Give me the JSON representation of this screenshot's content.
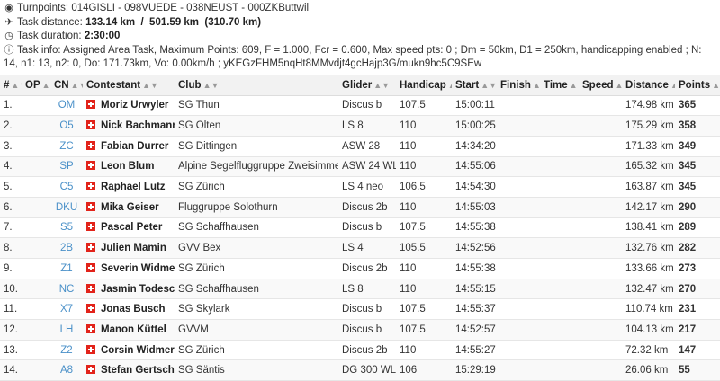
{
  "info": {
    "turnpoints_label": "Turnpoints:",
    "turnpoints_value": "014GISLI - 098VUEDE - 038NEUST - 000ZKButtwil",
    "distance_label": "Task distance:",
    "distance_value": "133.14 km  /  501.59 km  (310.70 km)",
    "duration_label": "Task duration:",
    "duration_value": "2:30:00",
    "taskinfo_label": "Task info:",
    "taskinfo_value": "Assigned Area Task, Maximum Points: 609, F = 1.000, Fcr = 0.600, Max speed pts: 0 ; Dm = 50km, D1 = 250km, handicapping enabled ; N: 14, n1: 13, n2: 0, Do: 171.73km, Vo: 0.00km/h ; yKEGzFHM5nqHt8MMvdjt4gcHajp3G/mukn9hc5C9SEw",
    "icons": {
      "turnpoints": "map-marker-icon",
      "distance": "plane-icon",
      "duration": "clock-icon",
      "taskinfo": "info-circle-icon"
    }
  },
  "table": {
    "headers": [
      "#",
      "OP",
      "CN",
      "Contestant",
      "Club",
      "Glider",
      "Handicap",
      "Start",
      "Finish",
      "Time",
      "Speed",
      "Distance",
      "Points"
    ],
    "rows": [
      {
        "rank": "1.",
        "op": "",
        "cn": "OM",
        "name": "Moriz Urwyler",
        "club": "SG Thun",
        "glider": "Discus b",
        "handicap": "107.5",
        "start": "15:00:11",
        "finish": "",
        "time": "",
        "speed": "",
        "distance": "174.98 km",
        "points": "365"
      },
      {
        "rank": "2.",
        "op": "",
        "cn": "O5",
        "name": "Nick Bachmann",
        "club": "SG Olten",
        "glider": "LS 8",
        "handicap": "110",
        "start": "15:00:25",
        "finish": "",
        "time": "",
        "speed": "",
        "distance": "175.29 km",
        "points": "358"
      },
      {
        "rank": "3.",
        "op": "",
        "cn": "ZC",
        "name": "Fabian Durrer",
        "club": "SG Dittingen",
        "glider": "ASW 28",
        "handicap": "110",
        "start": "14:34:20",
        "finish": "",
        "time": "",
        "speed": "",
        "distance": "171.33 km",
        "points": "349"
      },
      {
        "rank": "4.",
        "op": "",
        "cn": "SP",
        "name": "Leon Blum",
        "club": "Alpine Segelfluggruppe Zweisimmen",
        "glider": "ASW 24 WL",
        "handicap": "110",
        "start": "14:55:06",
        "finish": "",
        "time": "",
        "speed": "",
        "distance": "165.32 km",
        "points": "345"
      },
      {
        "rank": "5.",
        "op": "",
        "cn": "C5",
        "name": "Raphael Lutz",
        "club": "SG Zürich",
        "glider": "LS 4 neo",
        "handicap": "106.5",
        "start": "14:54:30",
        "finish": "",
        "time": "",
        "speed": "",
        "distance": "163.87 km",
        "points": "345"
      },
      {
        "rank": "6.",
        "op": "",
        "cn": "DKU",
        "name": "Mika Geiser",
        "club": "Fluggruppe Solothurn",
        "glider": "Discus 2b",
        "handicap": "110",
        "start": "14:55:03",
        "finish": "",
        "time": "",
        "speed": "",
        "distance": "142.17 km",
        "points": "290"
      },
      {
        "rank": "7.",
        "op": "",
        "cn": "S5",
        "name": "Pascal Peter",
        "club": "SG Schaffhausen",
        "glider": "Discus b",
        "handicap": "107.5",
        "start": "14:55:38",
        "finish": "",
        "time": "",
        "speed": "",
        "distance": "138.41 km",
        "points": "289"
      },
      {
        "rank": "8.",
        "op": "",
        "cn": "2B",
        "name": "Julien Mamin",
        "club": "GVV Bex",
        "glider": "LS 4",
        "handicap": "105.5",
        "start": "14:52:56",
        "finish": "",
        "time": "",
        "speed": "",
        "distance": "132.76 km",
        "points": "282"
      },
      {
        "rank": "9.",
        "op": "",
        "cn": "Z1",
        "name": "Severin Widmer",
        "club": "SG Zürich",
        "glider": "Discus 2b",
        "handicap": "110",
        "start": "14:55:38",
        "finish": "",
        "time": "",
        "speed": "",
        "distance": "133.66 km",
        "points": "273"
      },
      {
        "rank": "10.",
        "op": "",
        "cn": "NC",
        "name": "Jasmin Todesco",
        "club": "SG Schaffhausen",
        "glider": "LS 8",
        "handicap": "110",
        "start": "14:55:15",
        "finish": "",
        "time": "",
        "speed": "",
        "distance": "132.47 km",
        "points": "270"
      },
      {
        "rank": "11.",
        "op": "",
        "cn": "X7",
        "name": "Jonas Busch",
        "club": "SG Skylark",
        "glider": "Discus b",
        "handicap": "107.5",
        "start": "14:55:37",
        "finish": "",
        "time": "",
        "speed": "",
        "distance": "110.74 km",
        "points": "231"
      },
      {
        "rank": "12.",
        "op": "",
        "cn": "LH",
        "name": "Manon Küttel",
        "club": "GVVM",
        "glider": "Discus b",
        "handicap": "107.5",
        "start": "14:52:57",
        "finish": "",
        "time": "",
        "speed": "",
        "distance": "104.13 km",
        "points": "217"
      },
      {
        "rank": "13.",
        "op": "",
        "cn": "Z2",
        "name": "Corsin Widmer",
        "club": "SG Zürich",
        "glider": "Discus 2b",
        "handicap": "110",
        "start": "14:55:27",
        "finish": "",
        "time": "",
        "speed": "",
        "distance": "72.32 km",
        "points": "147"
      },
      {
        "rank": "14.",
        "op": "",
        "cn": "A8",
        "name": "Stefan Gertsch",
        "club": "SG Säntis",
        "glider": "DG 300 WL",
        "handicap": "106",
        "start": "15:29:19",
        "finish": "",
        "time": "",
        "speed": "",
        "distance": "26.06 km",
        "points": "55"
      }
    ]
  }
}
